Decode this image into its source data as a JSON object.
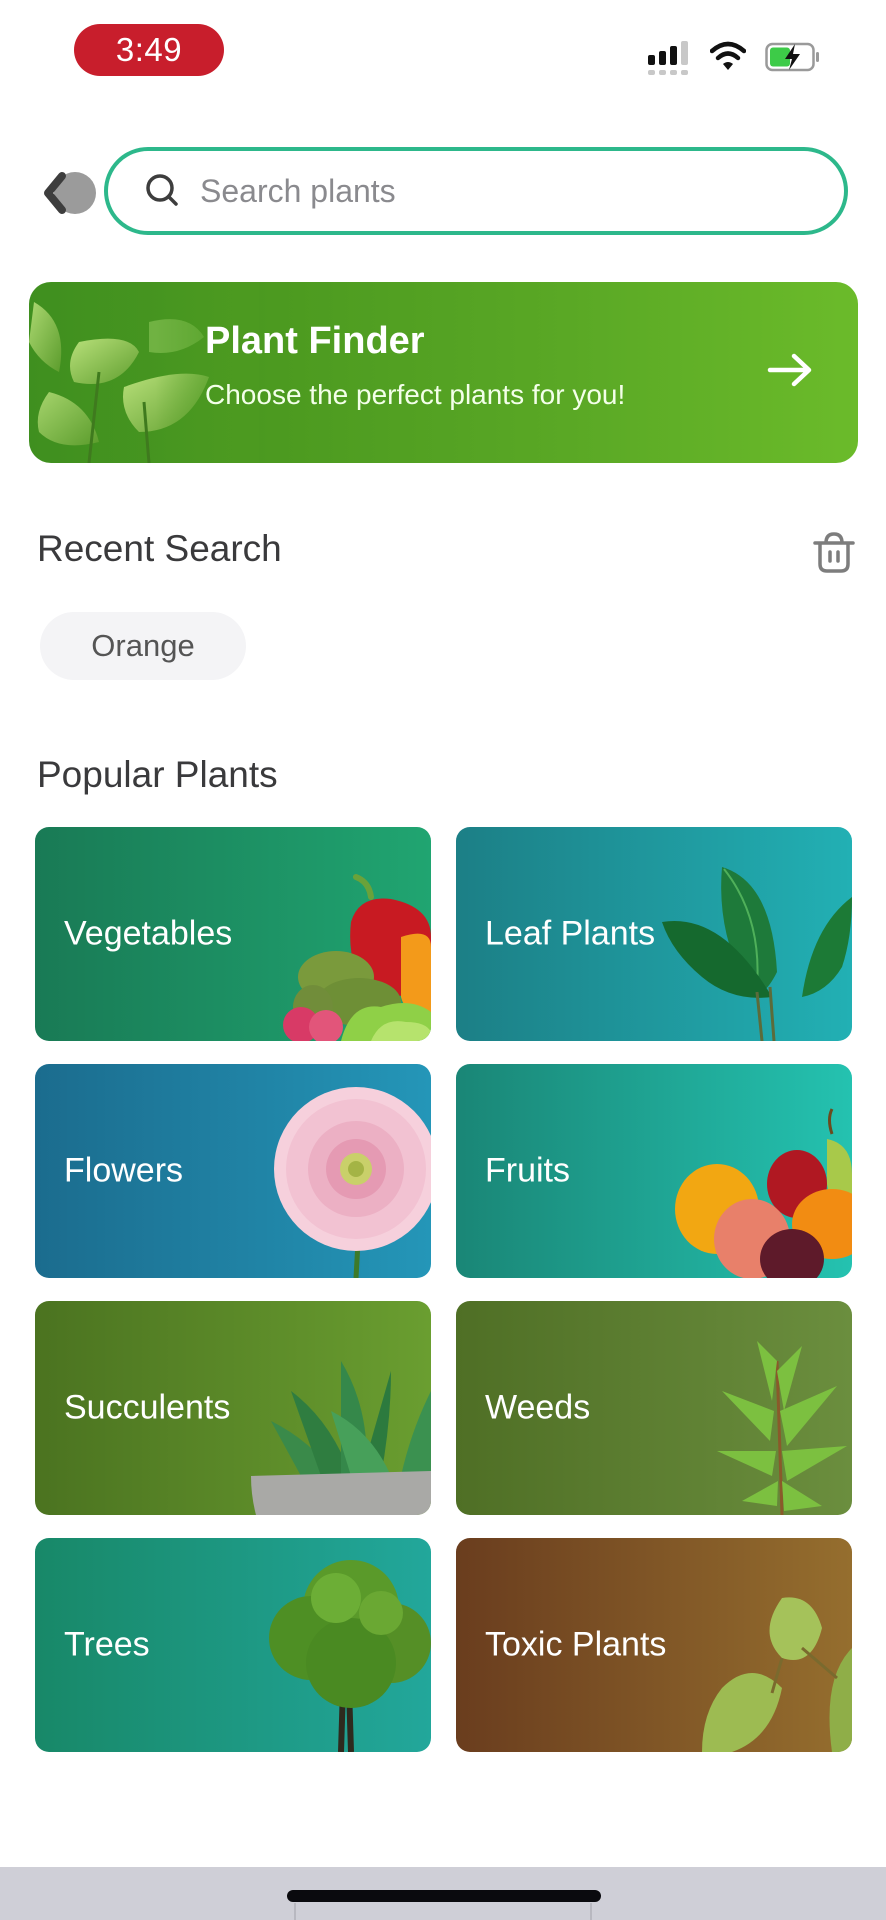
{
  "status_bar": {
    "time": "3:49",
    "time_pill_color": "#c81e2c",
    "icons": [
      "cellular-signal-icon",
      "wifi-icon",
      "battery-charging-icon"
    ]
  },
  "search": {
    "placeholder": "Search plants",
    "value": "",
    "border_color": "#2db88b",
    "back_icon": "chevron-left-icon",
    "search_icon": "magnifier-icon"
  },
  "banner": {
    "title": "Plant Finder",
    "subtitle": "Choose the perfect plants for you!",
    "icon": "arrow-right-icon",
    "color": "#5aa825"
  },
  "recent_search": {
    "title": "Recent Search",
    "clear_icon": "trash-icon",
    "items": [
      "Orange"
    ]
  },
  "popular_plants": {
    "title": "Popular Plants",
    "categories": [
      {
        "label": "Vegetables",
        "image": "vegetables",
        "colors": [
          "#197a55",
          "#20a571"
        ]
      },
      {
        "label": "Leaf Plants",
        "image": "leaf-plants",
        "colors": [
          "#1c7f86",
          "#22b0b4"
        ]
      },
      {
        "label": "Flowers",
        "image": "flower",
        "colors": [
          "#1b6c8e",
          "#2496b8"
        ]
      },
      {
        "label": "Fruits",
        "image": "fruits",
        "colors": [
          "#1a8676",
          "#24c2b0"
        ]
      },
      {
        "label": "Succulents",
        "image": "succulent",
        "colors": [
          "#4b7320",
          "#6a9e30"
        ]
      },
      {
        "label": "Weeds",
        "image": "weed",
        "colors": [
          "#4f6f25",
          "#6b8e3e"
        ]
      },
      {
        "label": "Trees",
        "image": "tree",
        "colors": [
          "#188868",
          "#22a79b"
        ]
      },
      {
        "label": "Toxic Plants",
        "image": "toxic-leaves",
        "colors": [
          "#6a3d1e",
          "#956e2e"
        ]
      }
    ]
  }
}
